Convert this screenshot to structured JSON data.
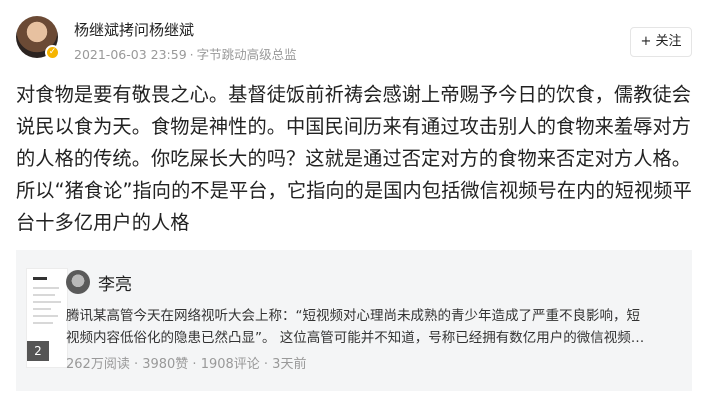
{
  "author": {
    "name": "杨继斌拷问杨继斌",
    "timestamp": "2021-06-03 23:59",
    "separator": "·",
    "title": "字节跳动高级总监",
    "badge_icon": "verified-icon",
    "badge_color": "#f5b400"
  },
  "follow_button": {
    "label": "+ 关注"
  },
  "post": {
    "text": "对食物是要有敬畏之心。基督徒饭前祈祷会感谢上帝赐予今日的饮食，儒教徒会说民以食为天。食物是神性的。中国民间历来有通过攻击别人的食物来羞辱对方的人格的传统。你吃屎长大的吗？这就是通过否定对方的食物来否定对方人格。所以“猪食论”指向的不是平台，它指向的是国内包括微信视频号在内的短视频平台十多亿用户的人格"
  },
  "quoted": {
    "author_name": "李亮",
    "image_count": "2",
    "text_line1": "腾讯某高管今天在网络视听大会上称：“短视频对心理尚未成熟的青少年造成了严重不良影响，短",
    "text_line2": "视频内容低俗化的隐患已然凸显”。 这位高管可能并不知道，号称已经拥有数亿用户的微信视频…",
    "stats": "262万阅读 · 3980赞 · 1908评论 · 3天前",
    "card_bg": "#f4f5f6"
  }
}
